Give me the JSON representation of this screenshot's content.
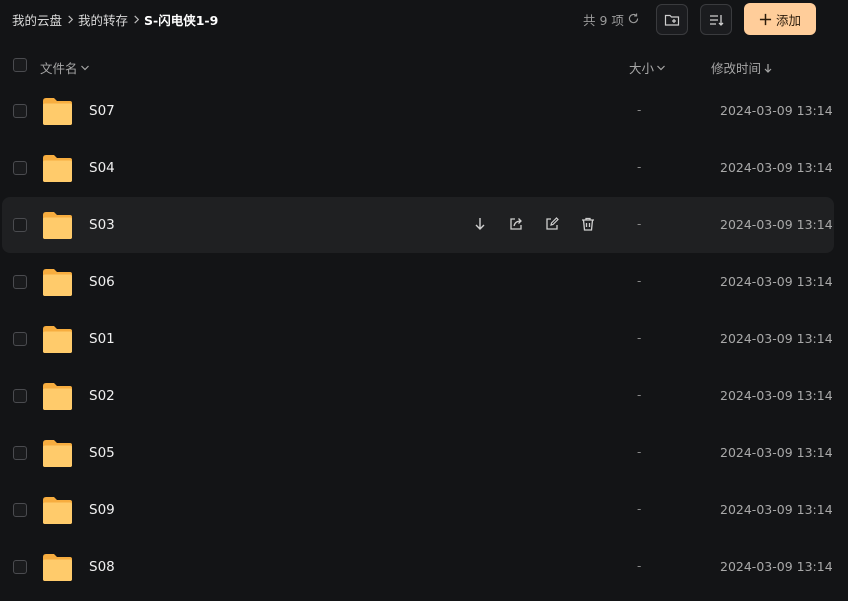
{
  "breadcrumb": [
    {
      "label": "我的云盘"
    },
    {
      "label": "我的转存"
    },
    {
      "label": "S-闪电侠1-9"
    }
  ],
  "item_count": "共 9 项",
  "add_label": "添加",
  "columns": {
    "name": "文件名",
    "size": "大小",
    "modified": "修改时间"
  },
  "files": [
    {
      "name": "S07",
      "size": "-",
      "modified": "2024-03-09 13:14",
      "hovered": false
    },
    {
      "name": "S04",
      "size": "-",
      "modified": "2024-03-09 13:14",
      "hovered": false
    },
    {
      "name": "S03",
      "size": "-",
      "modified": "2024-03-09 13:14",
      "hovered": true
    },
    {
      "name": "S06",
      "size": "-",
      "modified": "2024-03-09 13:14",
      "hovered": false
    },
    {
      "name": "S01",
      "size": "-",
      "modified": "2024-03-09 13:14",
      "hovered": false
    },
    {
      "name": "S02",
      "size": "-",
      "modified": "2024-03-09 13:14",
      "hovered": false
    },
    {
      "name": "S05",
      "size": "-",
      "modified": "2024-03-09 13:14",
      "hovered": false
    },
    {
      "name": "S09",
      "size": "-",
      "modified": "2024-03-09 13:14",
      "hovered": false
    },
    {
      "name": "S08",
      "size": "-",
      "modified": "2024-03-09 13:14",
      "hovered": false
    }
  ],
  "row_actions": [
    "download-icon",
    "share-icon",
    "rename-icon",
    "delete-icon"
  ],
  "colors": {
    "background": "#131416",
    "accent": "#ffcd9a",
    "folder": "#ffc65c",
    "row_hover": "#1f2022"
  }
}
